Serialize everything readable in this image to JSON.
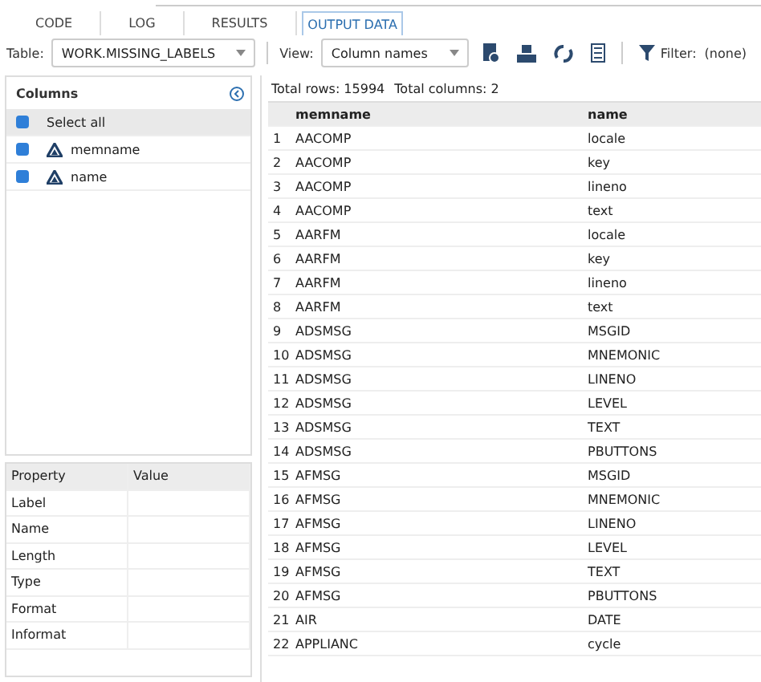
{
  "tabs": [
    {
      "label": "CODE",
      "selected": false
    },
    {
      "label": "LOG",
      "selected": false
    },
    {
      "label": "RESULTS",
      "selected": false
    },
    {
      "label": "OUTPUT DATA",
      "selected": true
    }
  ],
  "toolbar": {
    "table_label": "Table:",
    "table_value": "WORK.MISSING_LABELS",
    "view_label": "View:",
    "view_value": "Column names",
    "filter_label": "Filter:",
    "filter_value": "(none)"
  },
  "columns_panel": {
    "title": "Columns",
    "select_all": {
      "label": "Select all",
      "checked": true
    },
    "items": [
      {
        "name": "memname",
        "checked": true
      },
      {
        "name": "name",
        "checked": true
      }
    ]
  },
  "properties": {
    "headers": [
      "Property",
      "Value"
    ],
    "rows": [
      "Label",
      "Name",
      "Length",
      "Type",
      "Format",
      "Informat"
    ]
  },
  "summary": {
    "rows": "Total rows: 15994",
    "columns": "Total columns: 2"
  },
  "table": {
    "columns": [
      "",
      "memname",
      "name"
    ],
    "rows": [
      [
        "1",
        "AACOMP",
        "locale"
      ],
      [
        "2",
        "AACOMP",
        "key"
      ],
      [
        "3",
        "AACOMP",
        "lineno"
      ],
      [
        "4",
        "AACOMP",
        "text"
      ],
      [
        "5",
        "AARFM",
        "locale"
      ],
      [
        "6",
        "AARFM",
        "key"
      ],
      [
        "7",
        "AARFM",
        "lineno"
      ],
      [
        "8",
        "AARFM",
        "text"
      ],
      [
        "9",
        "ADSMSG",
        "MSGID"
      ],
      [
        "10",
        "ADSMSG",
        "MNEMONIC"
      ],
      [
        "11",
        "ADSMSG",
        "LINENO"
      ],
      [
        "12",
        "ADSMSG",
        "LEVEL"
      ],
      [
        "13",
        "ADSMSG",
        "TEXT"
      ],
      [
        "14",
        "ADSMSG",
        "PBUTTONS"
      ],
      [
        "15",
        "AFMSG",
        "MSGID"
      ],
      [
        "16",
        "AFMSG",
        "MNEMONIC"
      ],
      [
        "17",
        "AFMSG",
        "LINENO"
      ],
      [
        "18",
        "AFMSG",
        "LEVEL"
      ],
      [
        "19",
        "AFMSG",
        "TEXT"
      ],
      [
        "20",
        "AFMSG",
        "PBUTTONS"
      ],
      [
        "21",
        "AIR",
        "DATE"
      ],
      [
        "22",
        "APPLIANC",
        "cycle"
      ]
    ]
  }
}
